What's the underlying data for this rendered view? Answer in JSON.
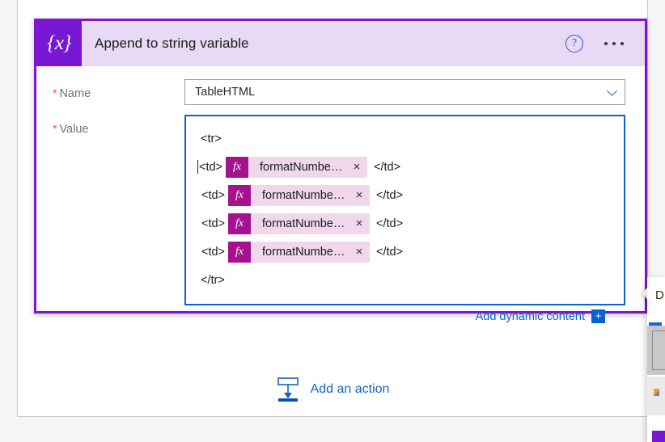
{
  "card": {
    "icon_glyph": "{x}",
    "icon_name": "variable-icon",
    "title": "Append to string variable",
    "help_label": "?",
    "more_label": "",
    "accent_color": "#8212d4",
    "header_bg": "#e8d9f5",
    "icon_bg": "#7719d4"
  },
  "fields": {
    "name": {
      "required_mark": "*",
      "label": "Name",
      "value": "TableHTML"
    },
    "value": {
      "required_mark": "*",
      "label": "Value",
      "lines": [
        {
          "type": "text",
          "text": "<tr>"
        },
        {
          "type": "token-line",
          "caret": true,
          "open_tag": "<td>",
          "token": {
            "fx": "fx",
            "label": "formatNumber…",
            "close": "×"
          },
          "close_tag": "</td>"
        },
        {
          "type": "token-line",
          "caret": false,
          "open_tag": "<td>",
          "token": {
            "fx": "fx",
            "label": "formatNumber…",
            "close": "×"
          },
          "close_tag": "</td>"
        },
        {
          "type": "token-line",
          "caret": false,
          "open_tag": "<td>",
          "token": {
            "fx": "fx",
            "label": "formatNumber…",
            "close": "×"
          },
          "close_tag": "</td>"
        },
        {
          "type": "token-line",
          "caret": false,
          "open_tag": "<td>",
          "token": {
            "fx": "fx",
            "label": "formatNumber…",
            "close": "×"
          },
          "close_tag": "</td>"
        },
        {
          "type": "text",
          "text": "</tr>"
        }
      ],
      "token_bg": "#f1d7ec",
      "token_fx_bg": "#a4128d",
      "focus_border": "#0a62d0"
    }
  },
  "dynamic_content": {
    "link_label": "Add dynamic content",
    "plus_label": "+",
    "link_color": "#1363c6"
  },
  "add_action": {
    "label": "Add an action",
    "icon_name": "insert-below-icon",
    "color": "#1363c6"
  }
}
